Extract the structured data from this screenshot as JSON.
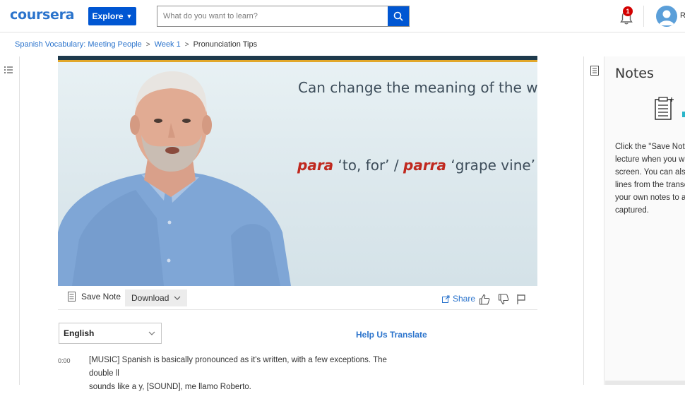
{
  "header": {
    "logo": "coursera",
    "explore_label": "Explore",
    "search_placeholder": "What do you want to learn?",
    "notification_count": "1",
    "user_initial": "R"
  },
  "breadcrumb": {
    "course": "Spanish Vocabulary: Meeting People",
    "week": "Week 1",
    "current": "Pronunciation Tips"
  },
  "video": {
    "slide_title": "Can change the meaning of the word",
    "word1": "para",
    "gloss1": "‘to, for’ /",
    "word2": "parra",
    "gloss2": "‘grape vine’"
  },
  "controls": {
    "save_note": "Save Note",
    "download": "Download",
    "share": "Share"
  },
  "transcript": {
    "language": "English",
    "help_translate": "Help Us Translate",
    "timestamp": "0:00",
    "line1": "[MUSIC] Spanish is basically pronounced as it's written, with a few exceptions. The double ll",
    "line2": "sounds like a y, [SOUND], me llamo Roberto."
  },
  "notes": {
    "title": "Notes",
    "desc_lines": [
      "Click the \"Save Note\"",
      "lecture when you wa",
      "screen. You can also",
      "lines from the transc",
      "your own notes to ar",
      "captured."
    ]
  },
  "colors": {
    "brand": "#2a73cc",
    "button": "#0056d2",
    "badge": "#d30000",
    "slide_emphasis": "#c0281e"
  }
}
